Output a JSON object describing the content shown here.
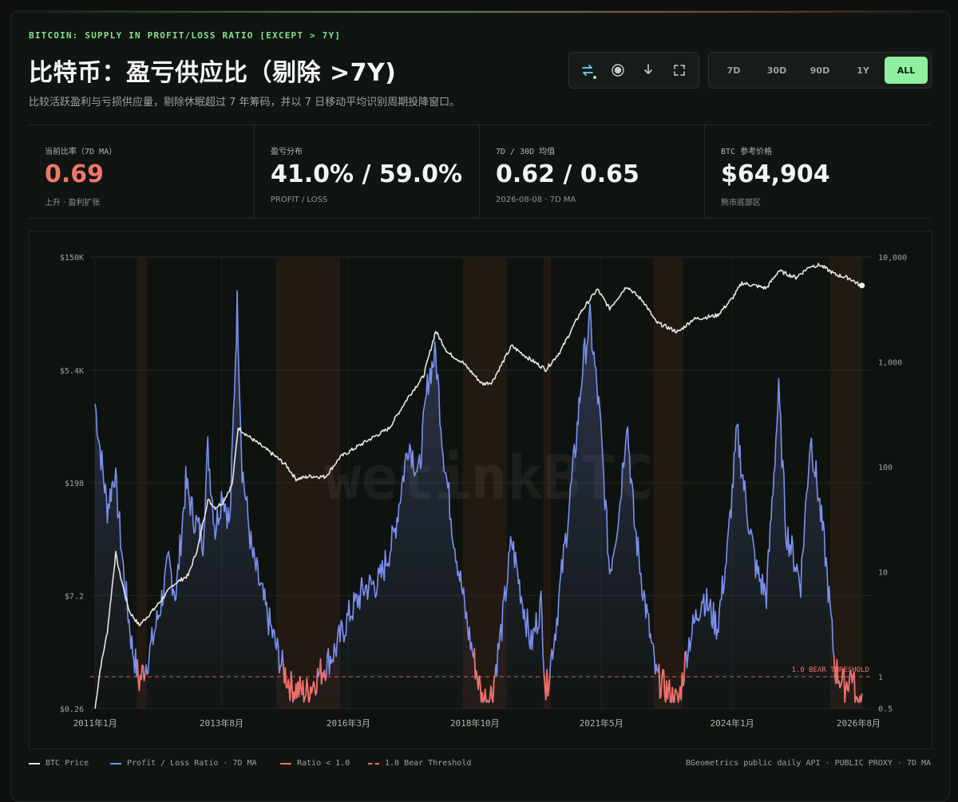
{
  "header": {
    "eyebrow": "BITCOIN: SUPPLY IN PROFIT/LOSS RATIO [EXCEPT > 7Y]",
    "title": "比特币：盈亏供应比（剔除 >7Y)",
    "subtitle": "比较活跃盈利与亏损供应量，剔除休眠超过 7 年筹码，并以 7 日移动平均识别周期投降窗口。"
  },
  "toolbar": {
    "tools": [
      {
        "icon": "swap-arrows-icon",
        "color": "#6fd3f2"
      },
      {
        "icon": "record-icon",
        "color": "#c7cdc8"
      },
      {
        "icon": "download-icon",
        "color": "#c7cdc8"
      },
      {
        "icon": "fullscreen-icon",
        "color": "#c7cdc8"
      }
    ],
    "ranges": [
      "7D",
      "30D",
      "90D",
      "1Y",
      "ALL"
    ],
    "active_range": "ALL"
  },
  "stats": [
    {
      "label": "当前比率（7D MA）",
      "value": "0.69",
      "note": "上升 · 盈利扩张",
      "value_color": "red"
    },
    {
      "label": "盈亏分布",
      "value": "41.0% / 59.0%",
      "note": "PROFIT / LOSS"
    },
    {
      "label": "7D / 30D 均值",
      "value": "0.62 / 0.65",
      "note": "2026-08-08 · 7D MA"
    },
    {
      "label": "BTC 参考价格",
      "value": "$64,904",
      "note": "熊市底部区"
    }
  ],
  "chart_data": {
    "type": "line",
    "watermark": "wetinkBTC",
    "left_axis_ticks": [
      "$150K",
      "$5.4K",
      "$198",
      "$7.2",
      "$0.26"
    ],
    "right_axis_ticks": [
      "10,000",
      "1,000",
      "100",
      "10",
      "1",
      "0.5"
    ],
    "right_axis_scale": "log",
    "x_ticks": [
      "2011年1月",
      "2013年8月",
      "2016年3月",
      "2018年10月",
      "2021年5月",
      "2024年1月",
      "2026年8月"
    ],
    "threshold": {
      "value": 1.0,
      "label": "1.0 BEAR THRESHOLD"
    },
    "series": [
      {
        "name": "BTC Price",
        "color": "#e6e6e1",
        "axis": "left",
        "points": [
          [
            2011.0,
            0.26
          ],
          [
            2011.1,
            0.8
          ],
          [
            2011.25,
            2.5
          ],
          [
            2011.42,
            25
          ],
          [
            2011.5,
            14
          ],
          [
            2011.7,
            4.5
          ],
          [
            2011.9,
            3
          ],
          [
            2012.2,
            4.8
          ],
          [
            2012.6,
            10
          ],
          [
            2012.9,
            13
          ],
          [
            2013.1,
            30
          ],
          [
            2013.3,
            120
          ],
          [
            2013.45,
            95
          ],
          [
            2013.6,
            110
          ],
          [
            2013.8,
            190
          ],
          [
            2013.92,
            1000
          ],
          [
            2014.1,
            800
          ],
          [
            2014.4,
            580
          ],
          [
            2014.7,
            420
          ],
          [
            2014.9,
            330
          ],
          [
            2015.1,
            220
          ],
          [
            2015.4,
            240
          ],
          [
            2015.7,
            235
          ],
          [
            2016.0,
            420
          ],
          [
            2016.5,
            650
          ],
          [
            2017.0,
            980
          ],
          [
            2017.4,
            2500
          ],
          [
            2017.7,
            4500
          ],
          [
            2017.95,
            17000
          ],
          [
            2018.2,
            9000
          ],
          [
            2018.5,
            6800
          ],
          [
            2018.9,
            3600
          ],
          [
            2019.1,
            3800
          ],
          [
            2019.5,
            11000
          ],
          [
            2019.8,
            8000
          ],
          [
            2020.2,
            5500
          ],
          [
            2020.5,
            9500
          ],
          [
            2020.9,
            29000
          ],
          [
            2021.25,
            58000
          ],
          [
            2021.5,
            33000
          ],
          [
            2021.85,
            64000
          ],
          [
            2022.2,
            40000
          ],
          [
            2022.45,
            22000
          ],
          [
            2022.9,
            16500
          ],
          [
            2023.2,
            24000
          ],
          [
            2023.7,
            27000
          ],
          [
            2024.0,
            44000
          ],
          [
            2024.2,
            70000
          ],
          [
            2024.7,
            60000
          ],
          [
            2024.95,
            100000
          ],
          [
            2025.3,
            82000
          ],
          [
            2025.6,
            115000
          ],
          [
            2025.8,
            118000
          ],
          [
            2026.1,
            90000
          ],
          [
            2026.4,
            80000
          ],
          [
            2026.6,
            66000
          ],
          [
            2026.65,
            64904
          ]
        ]
      },
      {
        "name": "Profit / Loss Ratio · 7D MA",
        "color": "#7b8ff0",
        "axis": "right",
        "points": [
          [
            2011.0,
            400
          ],
          [
            2011.1,
            150
          ],
          [
            2011.25,
            40
          ],
          [
            2011.4,
            90
          ],
          [
            2011.6,
            8
          ],
          [
            2011.75,
            2
          ],
          [
            2011.9,
            0.9
          ],
          [
            2012.1,
            1.6
          ],
          [
            2012.3,
            4
          ],
          [
            2012.5,
            12
          ],
          [
            2012.65,
            6
          ],
          [
            2012.85,
            70
          ],
          [
            2013.0,
            35
          ],
          [
            2013.2,
            20
          ],
          [
            2013.3,
            150
          ],
          [
            2013.45,
            25
          ],
          [
            2013.6,
            60
          ],
          [
            2013.75,
            28
          ],
          [
            2013.9,
            3600
          ],
          [
            2014.0,
            100
          ],
          [
            2014.2,
            15
          ],
          [
            2014.5,
            4
          ],
          [
            2014.8,
            1.3
          ],
          [
            2015.0,
            0.8
          ],
          [
            2015.3,
            0.7
          ],
          [
            2015.6,
            1.1
          ],
          [
            2015.9,
            1.8
          ],
          [
            2016.2,
            4
          ],
          [
            2016.5,
            7
          ],
          [
            2016.8,
            8
          ],
          [
            2017.1,
            22
          ],
          [
            2017.4,
            180
          ],
          [
            2017.6,
            80
          ],
          [
            2017.8,
            700
          ],
          [
            2017.95,
            1200
          ],
          [
            2018.1,
            150
          ],
          [
            2018.3,
            25
          ],
          [
            2018.6,
            3
          ],
          [
            2018.9,
            0.6
          ],
          [
            2019.1,
            0.7
          ],
          [
            2019.3,
            3
          ],
          [
            2019.5,
            20
          ],
          [
            2019.7,
            6
          ],
          [
            2019.9,
            2
          ],
          [
            2020.1,
            5
          ],
          [
            2020.2,
            0.7
          ],
          [
            2020.4,
            3
          ],
          [
            2020.6,
            20
          ],
          [
            2020.8,
            150
          ],
          [
            2020.95,
            900
          ],
          [
            2021.1,
            2500
          ],
          [
            2021.3,
            300
          ],
          [
            2021.5,
            10
          ],
          [
            2021.7,
            40
          ],
          [
            2021.85,
            300
          ],
          [
            2022.0,
            30
          ],
          [
            2022.2,
            6
          ],
          [
            2022.45,
            1.0
          ],
          [
            2022.7,
            0.7
          ],
          [
            2022.9,
            0.55
          ],
          [
            2023.1,
            2
          ],
          [
            2023.4,
            6
          ],
          [
            2023.7,
            3
          ],
          [
            2023.9,
            15
          ],
          [
            2024.1,
            220
          ],
          [
            2024.3,
            40
          ],
          [
            2024.5,
            10
          ],
          [
            2024.7,
            6
          ],
          [
            2024.95,
            500
          ],
          [
            2025.1,
            25
          ],
          [
            2025.4,
            8
          ],
          [
            2025.6,
            200
          ],
          [
            2025.75,
            60
          ],
          [
            2025.9,
            15
          ],
          [
            2026.1,
            1.2
          ],
          [
            2026.3,
            0.8
          ],
          [
            2026.45,
            1.1
          ],
          [
            2026.55,
            0.5
          ],
          [
            2026.65,
            0.69
          ]
        ]
      },
      {
        "name": "Ratio < 1.0",
        "color": "#ef6f66",
        "axis": "right"
      },
      {
        "name": "1.0 Bear Threshold",
        "color": "#ef6f66",
        "style": "dashed"
      }
    ],
    "bear_bands": [
      [
        2011.85,
        2012.05
      ],
      [
        2014.7,
        2016.0
      ],
      [
        2018.5,
        2019.4
      ],
      [
        2020.15,
        2020.3
      ],
      [
        2022.4,
        2023.0
      ],
      [
        2026.0,
        2026.65
      ]
    ],
    "source": "BGeometrics public daily API · PUBLIC PROXY · 7D MA"
  }
}
